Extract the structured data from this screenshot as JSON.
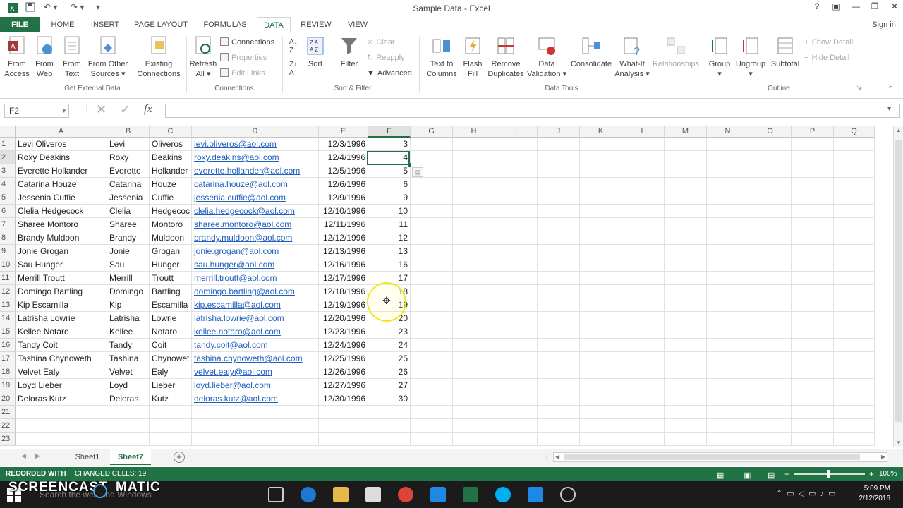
{
  "window": {
    "title": "Sample Data - Excel",
    "user": "Sign in"
  },
  "tabs": [
    "FILE",
    "HOME",
    "INSERT",
    "PAGE LAYOUT",
    "FORMULAS",
    "DATA",
    "REVIEW",
    "VIEW"
  ],
  "ribbon": {
    "get_external": {
      "from_access": [
        "From",
        "Access"
      ],
      "from_web": [
        "From",
        "Web"
      ],
      "from_text": [
        "From",
        "Text"
      ],
      "from_other": [
        "From Other",
        "Sources ▾"
      ],
      "existing": [
        "Existing",
        "Connections"
      ],
      "group": "Get External Data"
    },
    "connections": {
      "refresh": [
        "Refresh",
        "All ▾"
      ],
      "connections": "Connections",
      "properties": "Properties",
      "edit_links": "Edit Links",
      "group": "Connections"
    },
    "sort_filter": {
      "sort": "Sort",
      "filter": "Filter",
      "clear": "Clear",
      "reapply": "Reapply",
      "advanced": "Advanced",
      "group": "Sort & Filter"
    },
    "data_tools": {
      "text_to_columns": [
        "Text to",
        "Columns"
      ],
      "flash_fill": [
        "Flash",
        "Fill"
      ],
      "remove_dup": [
        "Remove",
        "Duplicates"
      ],
      "validation": [
        "Data",
        "Validation ▾"
      ],
      "consolidate": "Consolidate",
      "whatif": [
        "What-If",
        "Analysis ▾"
      ],
      "relationships": "Relationships",
      "group": "Data Tools"
    },
    "outline": {
      "group_btn": "Group",
      "ungroup": "Ungroup",
      "subtotal": "Subtotal",
      "show_detail": "Show Detail",
      "hide_detail": "Hide Detail",
      "group": "Outline"
    }
  },
  "formula_bar": {
    "name_box": "F2",
    "fx": "fx",
    "value": ""
  },
  "columns": [
    "A",
    "B",
    "C",
    "D",
    "E",
    "F",
    "G",
    "H",
    "I",
    "J",
    "K",
    "L",
    "M",
    "N",
    "O",
    "P",
    "Q"
  ],
  "rows": [
    [
      "Levi Oliveros",
      "Levi",
      "Oliveros",
      "levi.oliveros@aol.com",
      "12/3/1996",
      "3"
    ],
    [
      "Roxy Deakins",
      "Roxy",
      "Deakins",
      "roxy.deakins@aol.com",
      "12/4/1996",
      "4"
    ],
    [
      "Everette Hollander",
      "Everette",
      "Hollander",
      "everette.hollander@aol.com",
      "12/5/1996",
      "5"
    ],
    [
      "Catarina Houze",
      "Catarina",
      "Houze",
      "catarina.houze@aol.com",
      "12/6/1996",
      "6"
    ],
    [
      "Jessenia Cuffie",
      "Jessenia",
      "Cuffie",
      "jessenia.cuffie@aol.com",
      "12/9/1996",
      "9"
    ],
    [
      "Clelia Hedgecock",
      "Clelia",
      "Hedgecoc",
      "clelia.hedgecock@aol.com",
      "12/10/1996",
      "10"
    ],
    [
      "Sharee Montoro",
      "Sharee",
      "Montoro",
      "sharee.montoro@aol.com",
      "12/11/1996",
      "11"
    ],
    [
      "Brandy Muldoon",
      "Brandy",
      "Muldoon",
      "brandy.muldoon@aol.com",
      "12/12/1996",
      "12"
    ],
    [
      "Jonie Grogan",
      "Jonie",
      "Grogan",
      "jonie.grogan@aol.com",
      "12/13/1996",
      "13"
    ],
    [
      "Sau Hunger",
      "Sau",
      "Hunger",
      "sau.hunger@aol.com",
      "12/16/1996",
      "16"
    ],
    [
      "Merrill Troutt",
      "Merrill",
      "Troutt",
      "merrill.troutt@aol.com",
      "12/17/1996",
      "17"
    ],
    [
      "Domingo Bartling",
      "Domingo",
      "Bartling",
      "domingo.bartling@aol.com",
      "12/18/1996",
      "18"
    ],
    [
      "Kip Escamilla",
      "Kip",
      "Escamilla",
      "kip.escamilla@aol.com",
      "12/19/1996",
      "19"
    ],
    [
      "Latrisha Lowrie",
      "Latrisha",
      "Lowrie",
      "latrisha.lowrie@aol.com",
      "12/20/1996",
      "20"
    ],
    [
      "Kellee Notaro",
      "Kellee",
      "Notaro",
      "kellee.notaro@aol.com",
      "12/23/1996",
      "23"
    ],
    [
      "Tandy Coit",
      "Tandy",
      "Coit",
      "tandy.coit@aol.com",
      "12/24/1996",
      "24"
    ],
    [
      "Tashina Chynoweth",
      "Tashina",
      "Chynowet",
      "tashina.chynoweth@aol.com",
      "12/25/1996",
      "25"
    ],
    [
      "Velvet Ealy",
      "Velvet",
      "Ealy",
      "velvet.ealy@aol.com",
      "12/26/1996",
      "26"
    ],
    [
      "Loyd Lieber",
      "Loyd",
      "Lieber",
      "loyd.lieber@aol.com",
      "12/27/1996",
      "27"
    ],
    [
      "Deloras Kutz",
      "Deloras",
      "Kutz",
      "deloras.kutz@aol.com",
      "12/30/1996",
      "30"
    ],
    [
      "",
      "",
      "",
      "",
      "",
      ""
    ],
    [
      "",
      "",
      "",
      "",
      "",
      ""
    ],
    [
      "",
      "",
      "",
      "",
      "",
      ""
    ]
  ],
  "sheets": [
    "Sheet1",
    "Sheet7"
  ],
  "status": {
    "left": "RECORDED WITH",
    "changed": "CHANGED CELLS: 19",
    "zoom": "100%"
  },
  "watermark": "SCREENCAST",
  "watermark2": "MATIC",
  "taskbar": {
    "search": "Search the web and Windows",
    "time": "5:09 PM",
    "date": "2/12/2016"
  },
  "colors": {
    "excel_green": "#217346",
    "link": "#1f5fbf",
    "highlight": "#f2e600"
  }
}
